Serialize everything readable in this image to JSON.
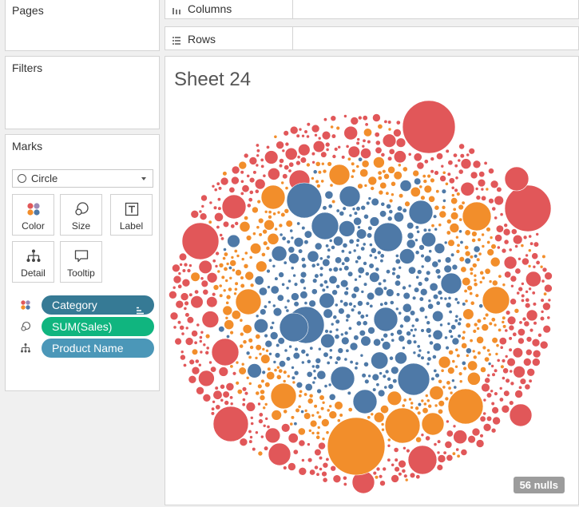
{
  "cards": {
    "pages": "Pages",
    "filters": "Filters",
    "marks": "Marks"
  },
  "marks": {
    "mark_type": "Circle",
    "buttons": {
      "color": "Color",
      "size": "Size",
      "label": "Label",
      "detail": "Detail",
      "tooltip": "Tooltip"
    },
    "pills": [
      {
        "label": "Category",
        "encoding": "color",
        "color": "#367a95"
      },
      {
        "label": "SUM(Sales)",
        "encoding": "size",
        "color": "#10b57f"
      },
      {
        "label": "Product Name",
        "encoding": "detail",
        "color": "#4b97b8"
      }
    ]
  },
  "shelves": {
    "columns": "Columns",
    "rows": "Rows"
  },
  "sheet": {
    "title": "Sheet 24",
    "nulls_badge": "56 nulls"
  },
  "chart_data": {
    "type": "packed-bubble",
    "title": "Sheet 24",
    "color_encoding": "Category",
    "size_encoding": "SUM(Sales)",
    "detail_encoding": "Product Name",
    "color_groups": [
      {
        "color": "#4e79a7",
        "position": "center"
      },
      {
        "color": "#f28e2b",
        "position": "middle ring"
      },
      {
        "color": "#e15759",
        "position": "outer ring"
      }
    ],
    "nulls": 56
  }
}
